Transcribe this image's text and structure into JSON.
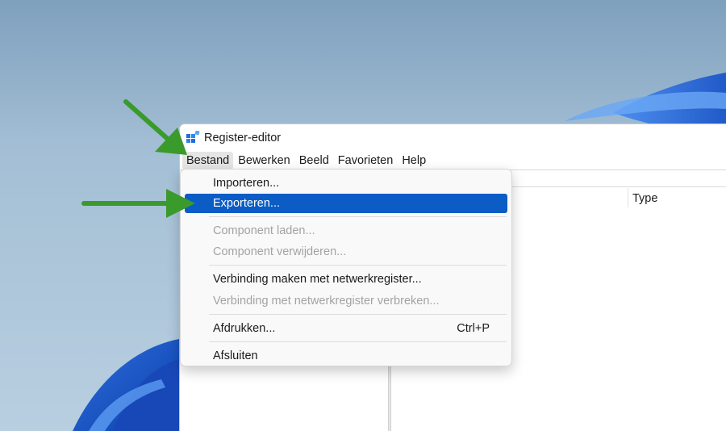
{
  "window": {
    "title": "Register-editor"
  },
  "menubar": {
    "items": [
      {
        "label": "Bestand",
        "active": true
      },
      {
        "label": "Bewerken",
        "active": false
      },
      {
        "label": "Beeld",
        "active": false
      },
      {
        "label": "Favorieten",
        "active": false
      },
      {
        "label": "Help",
        "active": false
      }
    ]
  },
  "list": {
    "column_type": "Type"
  },
  "file_menu": {
    "importeren": "Importeren...",
    "exporteren": "Exporteren...",
    "component_laden": "Component laden...",
    "component_verwijderen": "Component verwijderen...",
    "verbinding_maken": "Verbinding maken met netwerkregister...",
    "verbinding_verbreken": "Verbinding met netwerkregister verbreken...",
    "afdrukken": "Afdrukken...",
    "afdrukken_shortcut": "Ctrl+P",
    "afsluiten": "Afsluiten"
  },
  "colors": {
    "highlight": "#0b5cc5",
    "arrow": "#3a9a2c",
    "disabled_text": "#a3a3a3"
  }
}
